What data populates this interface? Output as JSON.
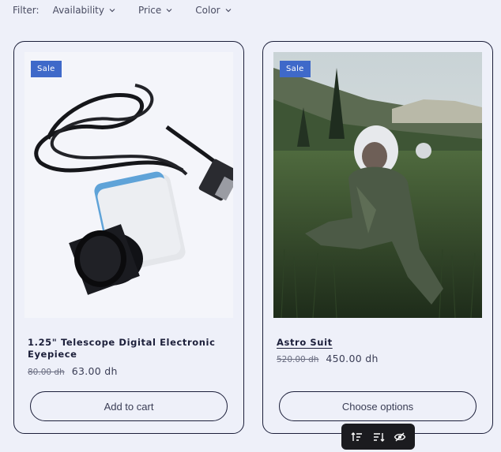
{
  "filter": {
    "label": "Filter:",
    "options": [
      "Availability",
      "Price",
      "Color"
    ]
  },
  "products": [
    {
      "badge": "Sale",
      "title": "1.25\" Telescope Digital Electronic Eyepiece",
      "old_price": "80.00 dh",
      "price": "63.00 dh",
      "cta": "Add to cart"
    },
    {
      "badge": "Sale",
      "title": "Astro Suit",
      "old_price": "520.00 dh",
      "price": "450.00 dh",
      "cta": "Choose options"
    }
  ],
  "toolbar": {
    "icons": [
      "sort-ascending-icon",
      "sort-descending-icon",
      "hide-icon"
    ]
  },
  "colors": {
    "accent": "#3f69c9",
    "background": "#eef0f9",
    "text": "#1c1f3a"
  }
}
